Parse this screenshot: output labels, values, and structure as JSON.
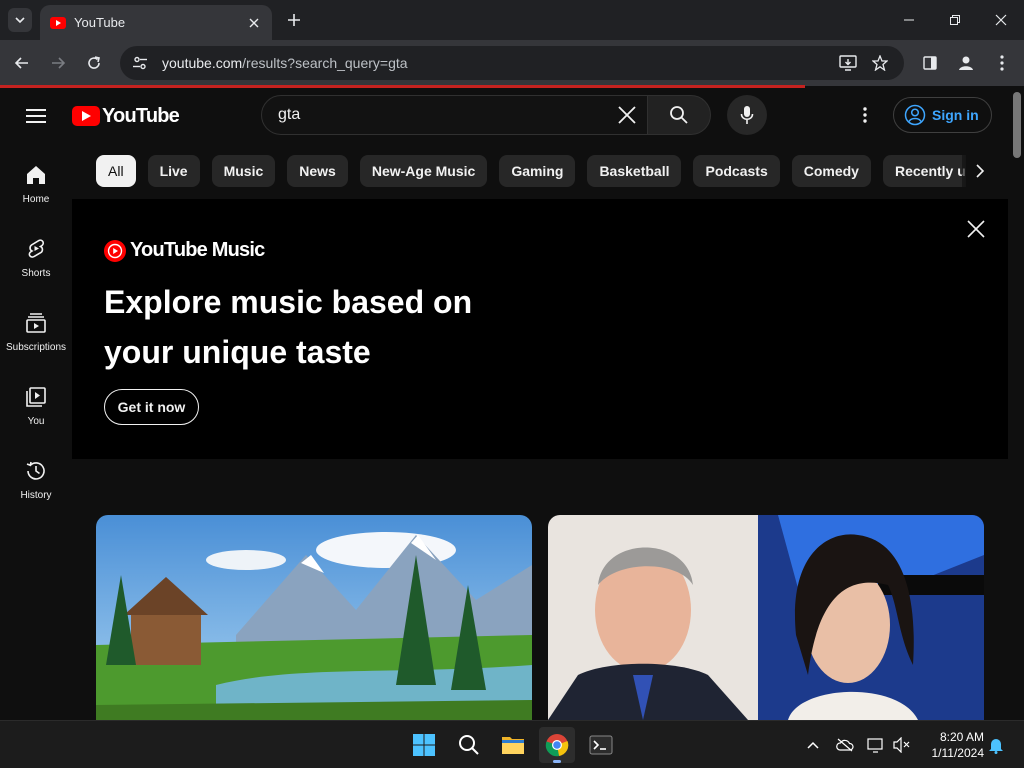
{
  "browser": {
    "tab_title": "YouTube",
    "url_host": "youtube.com",
    "url_path": "/results?search_query=gta"
  },
  "masthead": {
    "logo_text": "YouTube",
    "search_query": "gta",
    "signin_label": "Sign in"
  },
  "sidebar": {
    "items": [
      {
        "label": "Home",
        "icon": "home-icon"
      },
      {
        "label": "Shorts",
        "icon": "shorts-icon"
      },
      {
        "label": "Subscriptions",
        "icon": "subscriptions-icon"
      },
      {
        "label": "You",
        "icon": "you-icon"
      },
      {
        "label": "History",
        "icon": "history-icon"
      }
    ]
  },
  "chips": [
    "All",
    "Live",
    "Music",
    "News",
    "New-Age Music",
    "Gaming",
    "Basketball",
    "Podcasts",
    "Comedy",
    "Recently uploaded"
  ],
  "banner": {
    "logo_text": "YouTube Music",
    "headline_line1": "Explore music based on",
    "headline_line2": "your unique taste",
    "cta_label": "Get it now"
  },
  "taskbar": {
    "time": "8:20 AM",
    "date": "1/11/2024"
  },
  "colors": {
    "brand_red": "#ff0000",
    "link_blue": "#3ea6ff",
    "background": "#0f0f0f"
  }
}
